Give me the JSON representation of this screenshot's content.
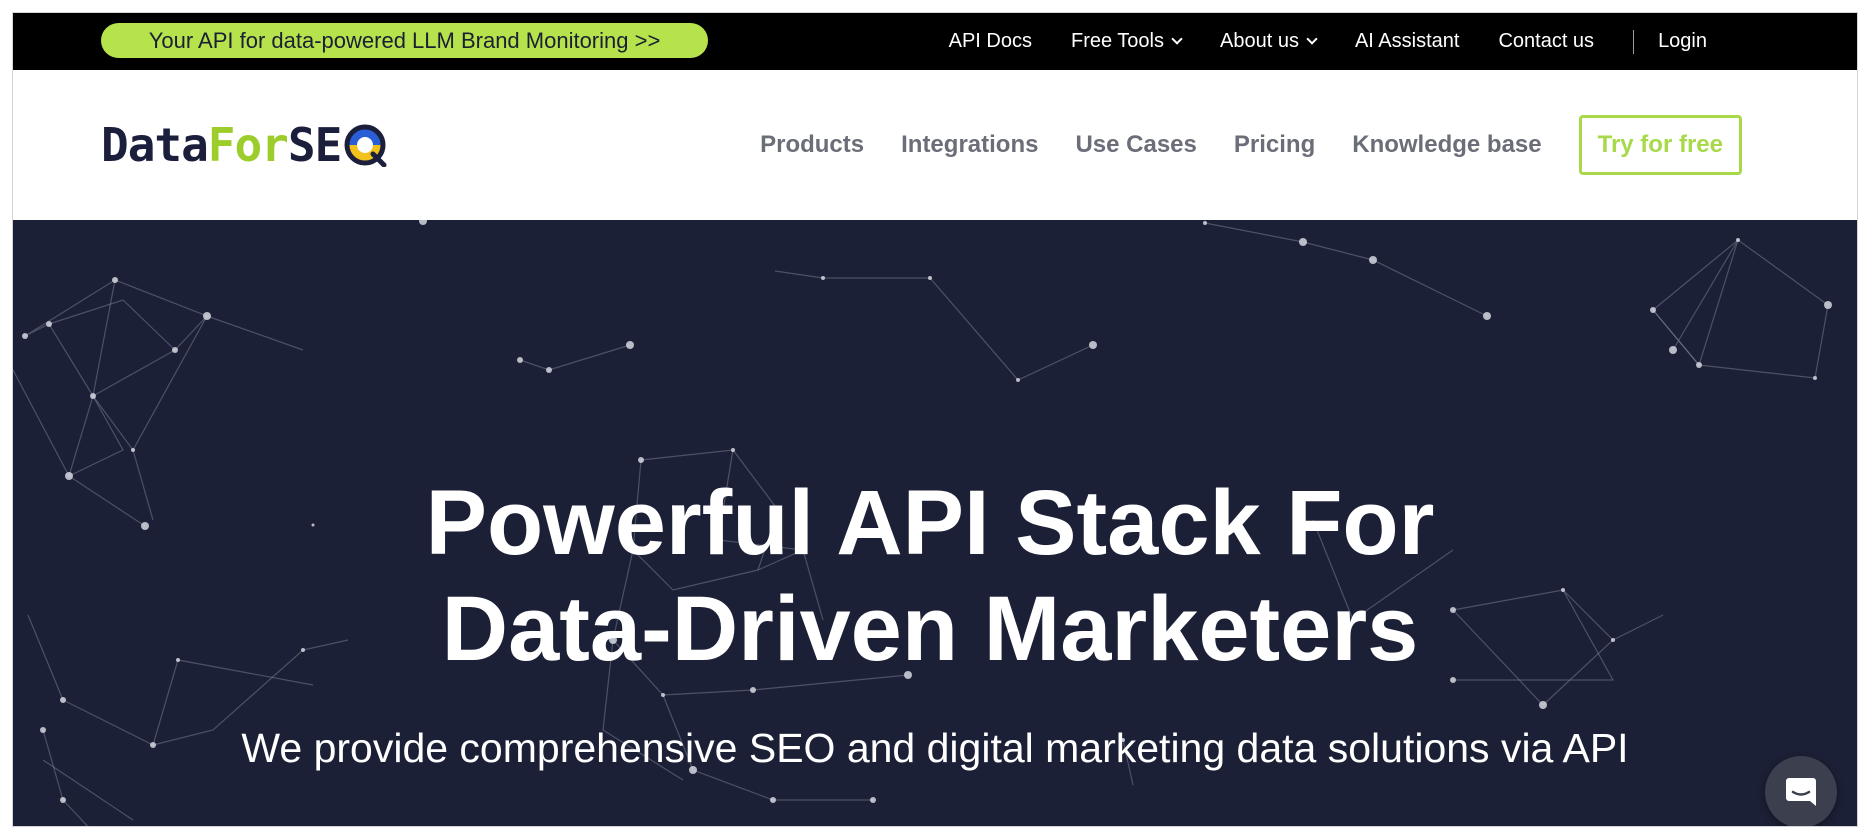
{
  "topbar": {
    "promo": "Your API for data-powered LLM Brand Monitoring >>",
    "links": {
      "api_docs": "API Docs",
      "free_tools": "Free Tools",
      "about_us": "About us",
      "ai_assistant": "AI Assistant",
      "contact_us": "Contact us",
      "login": "Login"
    }
  },
  "logo": {
    "part1": "Data",
    "part2": "For",
    "part3": "SE"
  },
  "nav": {
    "products": "Products",
    "integrations": "Integrations",
    "use_cases": "Use Cases",
    "pricing": "Pricing",
    "knowledge_base": "Knowledge base",
    "cta": "Try for free"
  },
  "hero": {
    "title_line1": "Powerful API Stack For",
    "title_line2": "Data-Driven Marketers",
    "subtitle": "We provide comprehensive SEO and digital marketing data solutions via API"
  },
  "icons": {
    "dropdown": "chevron-down-icon",
    "chat": "chat-bubble-icon",
    "logo_mark": "magnifier-o-icon"
  },
  "colors": {
    "accent": "#b6e34c",
    "cta_border": "#a8d94a",
    "hero_bg": "#1c2036",
    "logo_dark": "#1b1f3b",
    "logo_green": "#9ccd2a",
    "logo_yellow": "#f2c21b",
    "logo_blue": "#2a5ed6"
  }
}
